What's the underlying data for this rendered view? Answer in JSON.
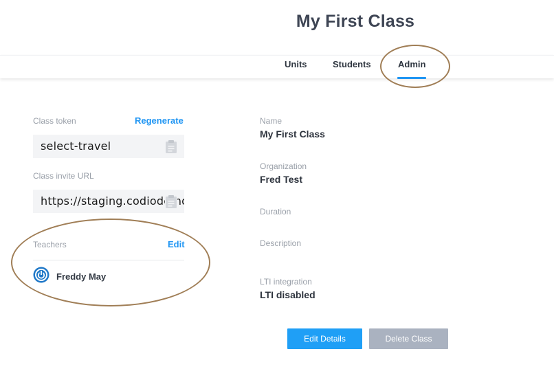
{
  "page": {
    "title": "My First Class"
  },
  "tabs": [
    {
      "label": "Units"
    },
    {
      "label": "Students"
    },
    {
      "label": "Admin",
      "active": true
    }
  ],
  "left": {
    "class_token_label": "Class token",
    "regenerate_label": "Regenerate",
    "class_token_value": "select-travel",
    "invite_url_label": "Class invite URL",
    "invite_url_value": "https://staging.codiodemo.com",
    "teachers_label": "Teachers",
    "edit_label": "Edit",
    "teachers": [
      {
        "name": "Freddy May"
      }
    ]
  },
  "details": {
    "name_label": "Name",
    "name_value": "My First Class",
    "organization_label": "Organization",
    "organization_value": "Fred Test",
    "duration_label": "Duration",
    "description_label": "Description",
    "lti_label": "LTI integration",
    "lti_value": "LTI disabled"
  },
  "actions": {
    "edit_details_label": "Edit Details",
    "delete_class_label": "Delete Class"
  },
  "colors": {
    "accent": "#2196f3",
    "primary_button": "#1f9ff6",
    "disabled_button": "#aab2c0",
    "annotation": "#a07e56"
  },
  "icons": [
    "clipboard-icon",
    "power-icon"
  ]
}
